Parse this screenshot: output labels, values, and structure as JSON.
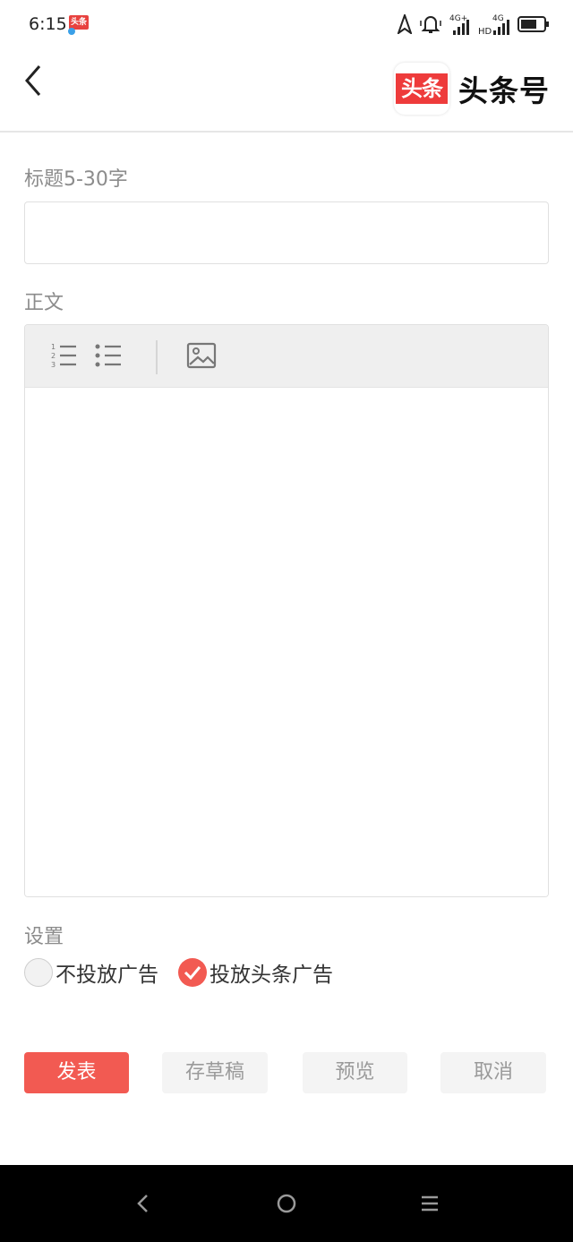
{
  "status_bar": {
    "time": "6:15",
    "app_icon_text": "头条",
    "network_1": "4G+",
    "network_2": "4G",
    "hd": "HD"
  },
  "header": {
    "logo_badge": "头条",
    "logo_text": "头条号"
  },
  "form": {
    "title_label": "标题5-30字",
    "title_value": "",
    "body_label": "正文",
    "settings_label": "设置",
    "ad_options": [
      {
        "label": "不投放广告",
        "selected": false
      },
      {
        "label": "投放头条广告",
        "selected": true
      }
    ]
  },
  "actions": {
    "publish": "发表",
    "save_draft": "存草稿",
    "preview": "预览",
    "cancel": "取消"
  },
  "colors": {
    "accent": "#f25a52",
    "brand_red": "#ee3b3b",
    "nav_bar": "#000000"
  }
}
